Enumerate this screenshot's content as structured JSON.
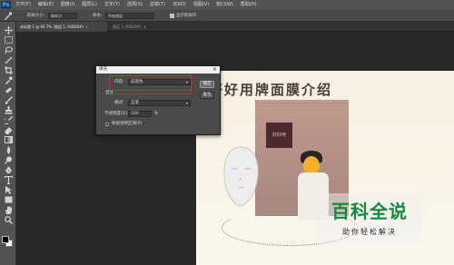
{
  "app": {
    "logo": "Ps",
    "menu": [
      "文件(F)",
      "编辑(E)",
      "图像(I)",
      "图层(L)",
      "文字(Y)",
      "选择(S)",
      "滤镜(T)",
      "3D(D)",
      "视图(V)",
      "窗口(W)",
      "帮助(H)"
    ]
  },
  "options": {
    "size_label": "取样大小:",
    "size_value": "取样点",
    "sample_label": "样本:",
    "sample_value": "所有图层",
    "show_ring_label": "显示取样环"
  },
  "tabs": [
    {
      "label": "未标题-1 @ 66.7% (图层 1, RGB/8#)",
      "active": true
    },
    {
      "label": "图层 1, RGB/8#)",
      "active": false
    }
  ],
  "tools": [
    "move-icon",
    "marquee-icon",
    "lasso-icon",
    "magic-wand-icon",
    "crop-icon",
    "eyedropper-icon",
    "healing-brush-icon",
    "brush-icon",
    "clone-stamp-icon",
    "history-brush-icon",
    "eraser-icon",
    "gradient-icon",
    "blur-icon",
    "dodge-icon",
    "pen-icon",
    "type-icon",
    "path-selection-icon",
    "rectangle-icon",
    "hand-icon",
    "zoom-icon"
  ],
  "colors": {
    "foreground": "#000000",
    "background": "#ffffff",
    "highlight": "#e4262b"
  },
  "artwork": {
    "title": "好好用牌面膜介绍",
    "pack_label": "好好用"
  },
  "dialog": {
    "title": "填充",
    "close": "×",
    "contents_label": "内容:",
    "contents_value": "前景色",
    "blending_label": "混合",
    "mode_label": "模式:",
    "mode_value": "正常",
    "opacity_label": "不透明度(O):",
    "opacity_value": "100",
    "opacity_unit": "%",
    "preserve_label": "保留透明区域(P)",
    "ok_label": "确定",
    "reset_label": "复位"
  },
  "watermark": {
    "title": "百科全说",
    "subtitle": "助你轻松解决"
  }
}
